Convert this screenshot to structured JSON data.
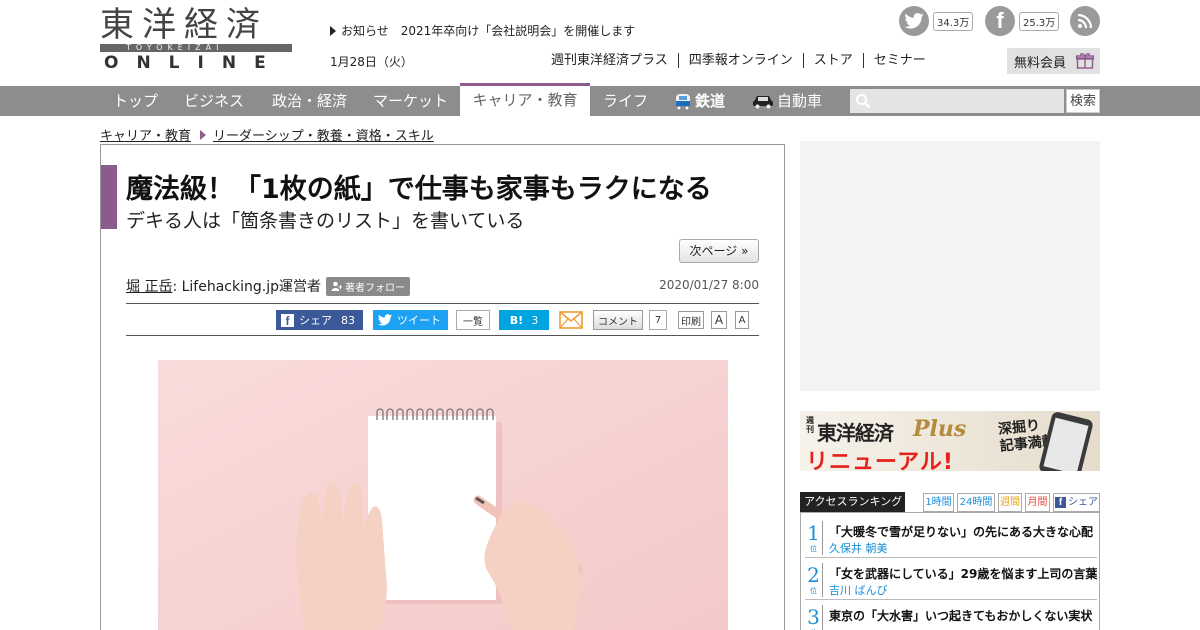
{
  "header": {
    "logo": {
      "kanji": "東洋経済",
      "roman": "TOYOKEIZAI",
      "online": "ONLINE"
    },
    "notice": {
      "label": "お知らせ",
      "text": "2021年卒向け「会社説明会」を開催します"
    },
    "date": "1月28日（火）",
    "twitter": {
      "icon": "twitter-icon",
      "count": "34.3万"
    },
    "facebook": {
      "icon": "facebook-icon",
      "count": "25.3万"
    },
    "rss": {
      "icon": "rss-icon"
    },
    "links": [
      "週刊東洋経済プラス",
      "四季報オンライン",
      "ストア",
      "セミナー"
    ],
    "member_label": "無料会員"
  },
  "nav": {
    "items": [
      "トップ",
      "ビジネス",
      "政治・経済",
      "マーケット",
      "キャリア・教育",
      "ライフ",
      "鉄道",
      "自動車"
    ],
    "active": "キャリア・教育",
    "search_placeholder": "",
    "search_label": "検索"
  },
  "breadcrumb": [
    "キャリア・教育",
    "リーダーシップ・教養・資格・スキル"
  ],
  "article": {
    "title": "魔法級！「1枚の紙」で仕事も家事もラクになる",
    "subtitle": "デキる人は「箇条書きのリスト」を書いている",
    "next_page": "次ページ »",
    "author_name": "堀 正岳",
    "author_role": " : Lifehacking.jp運営者",
    "follow_label": "著者フォロー",
    "date": "2020/01/27 8:00",
    "share": {
      "fb_label": "シェア",
      "fb_count": "83",
      "tw_label": "ツイート",
      "tw_list": "一覧",
      "hb_label": "B!",
      "hb_count": "3",
      "comment_label": "コメント",
      "comment_count": "7",
      "print_label": "印刷",
      "font_big": "A",
      "font_small": "A"
    }
  },
  "sidebar": {
    "plus_banner": {
      "shuukan": "週刊",
      "brand": "東洋経済",
      "plus": "Plus",
      "renewal": "リニューアル!",
      "tagline": "深掘り\n記事満載"
    },
    "ranking": {
      "title": "アクセスランキング",
      "tabs": [
        "1時間",
        "24時間",
        "週間",
        "月間",
        "シェア"
      ],
      "items": [
        {
          "rank": "1",
          "suffix": "位",
          "title": "「大暖冬で雪が足りない」の先にある大きな心配",
          "author": "久保井 朝美"
        },
        {
          "rank": "2",
          "suffix": "位",
          "title": "「女を武器にしている」29歳を悩ます上司の言葉",
          "author": "吉川 ばんび"
        },
        {
          "rank": "3",
          "suffix": "位",
          "title": "東京の「大水害」いつ起きてもおかしくない実状",
          "author": ""
        }
      ]
    }
  },
  "colors": {
    "accent": "#8c5b8e",
    "nav_bg": "#8d8d8d",
    "facebook": "#3b5998",
    "twitter": "#1da1f2",
    "hatena": "#00a4de",
    "rank": "#1a8fd6"
  }
}
